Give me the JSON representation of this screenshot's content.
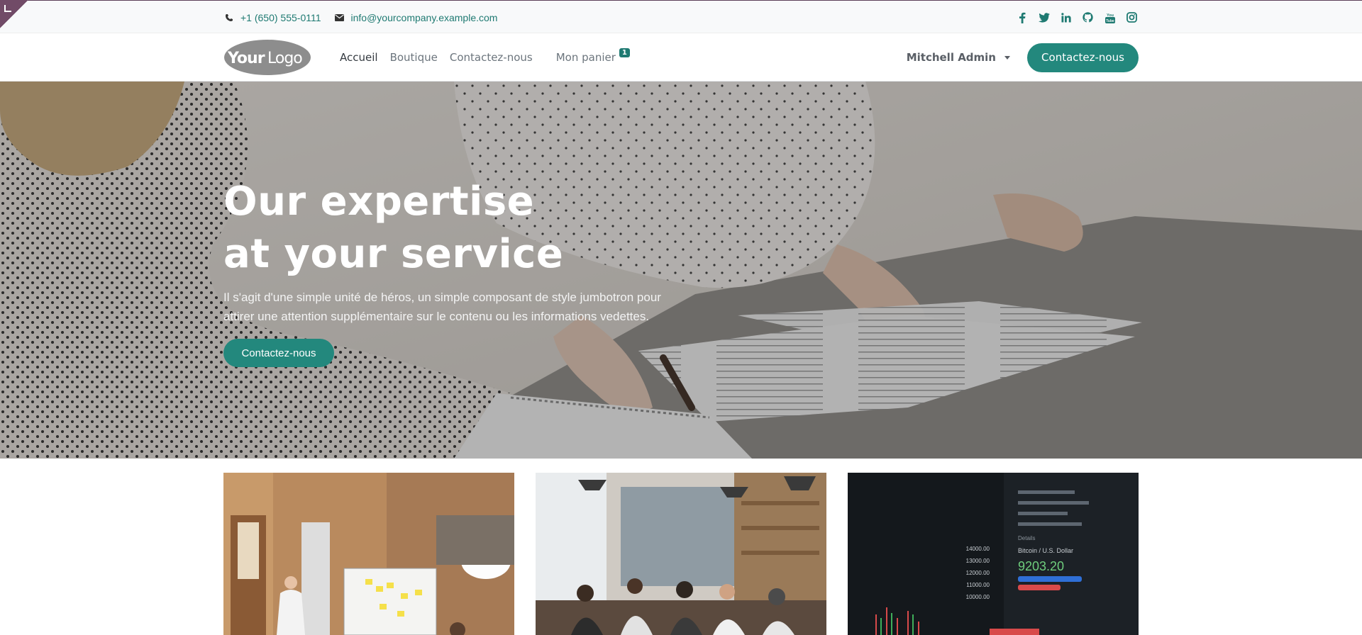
{
  "topbar": {
    "phone": "+1 (650) 555-0111",
    "email": "info@yourcompany.example.com",
    "social_icons": [
      "facebook-icon",
      "twitter-icon",
      "linkedin-icon",
      "github-icon",
      "youtube-icon",
      "instagram-icon"
    ]
  },
  "navbar": {
    "logo_text": "YourLogo",
    "links": [
      "Accueil",
      "Boutique",
      "Contactez-nous"
    ],
    "cart_label": "Mon panier",
    "cart_count": "1",
    "user_name": "Mitchell Admin",
    "cta_label": "Contactez-nous"
  },
  "hero": {
    "title_line1": "Our expertise",
    "title_line2": "at your service",
    "text": "Il s'agit d'une simple unité de héros, un simple composant de style jumbotron pour attirer une attention supplémentaire sur le contenu ou les informations vedettes.",
    "button_label": "Contactez-nous"
  },
  "cards": {
    "chart_ticks": [
      "14000.00",
      "13000.00",
      "12000.00",
      "11000.00",
      "10000.00"
    ],
    "chart_pair_label": "Bitcoin / U.S. Dollar",
    "chart_price": "9203.20",
    "chart_details_label": "Details"
  },
  "colors": {
    "accent": "#23887d",
    "link": "#1f7a72",
    "badge": "#714b67"
  }
}
